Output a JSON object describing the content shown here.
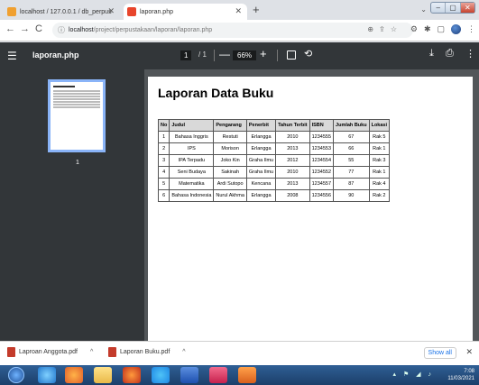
{
  "tabs": [
    {
      "label": "localhost / 127.0.0.1 / db_perpus",
      "active": false
    },
    {
      "label": "laporan.php",
      "active": true
    }
  ],
  "window_controls": [
    "–",
    "▢",
    "✕"
  ],
  "address": {
    "host": "localhost",
    "path": "/project/perpustakaan/laporan/laporan.php"
  },
  "pdf_toolbar": {
    "title": "laporan.php",
    "page_current": "1",
    "page_total": "/ 1",
    "zoom": "66%"
  },
  "thumbnail": {
    "page_label": "1"
  },
  "document": {
    "title": "Laporan Data Buku",
    "columns": [
      "No",
      "Judul",
      "Pengarang",
      "Penerbit",
      "Tahun Terbit",
      "ISBN",
      "Jumlah Buku",
      "Lokasi"
    ],
    "rows": [
      [
        "1",
        "Bahasa Inggris",
        "Restuti",
        "Erlangga",
        "2010",
        "1234555",
        "67",
        "Rak 5"
      ],
      [
        "2",
        "IPS",
        "Morison",
        "Erlangga",
        "2013",
        "1234553",
        "66",
        "Rak 1"
      ],
      [
        "3",
        "IPA Terpadu",
        "Joko Kin",
        "Graha Ilmu",
        "2012",
        "1234554",
        "55",
        "Rak 3"
      ],
      [
        "4",
        "Seni Budaya",
        "Sakinah",
        "Graha Ilmu",
        "2010",
        "1234552",
        "77",
        "Rak 1"
      ],
      [
        "5",
        "Matematika",
        "Ardi Sutopo",
        "Kencana",
        "2013",
        "1234557",
        "87",
        "Rak 4"
      ],
      [
        "6",
        "Bahasa Indonesia",
        "Nurul Akhma",
        "Erlangga",
        "2008",
        "1234556",
        "90",
        "Rak 2"
      ]
    ]
  },
  "downloads": {
    "items": [
      {
        "name": "Laproan Anggota.pdf"
      },
      {
        "name": "Laporan Buku.pdf"
      }
    ],
    "show_all": "Show all"
  },
  "taskbar": {
    "time": "7:08",
    "date": "11/03/2021"
  }
}
